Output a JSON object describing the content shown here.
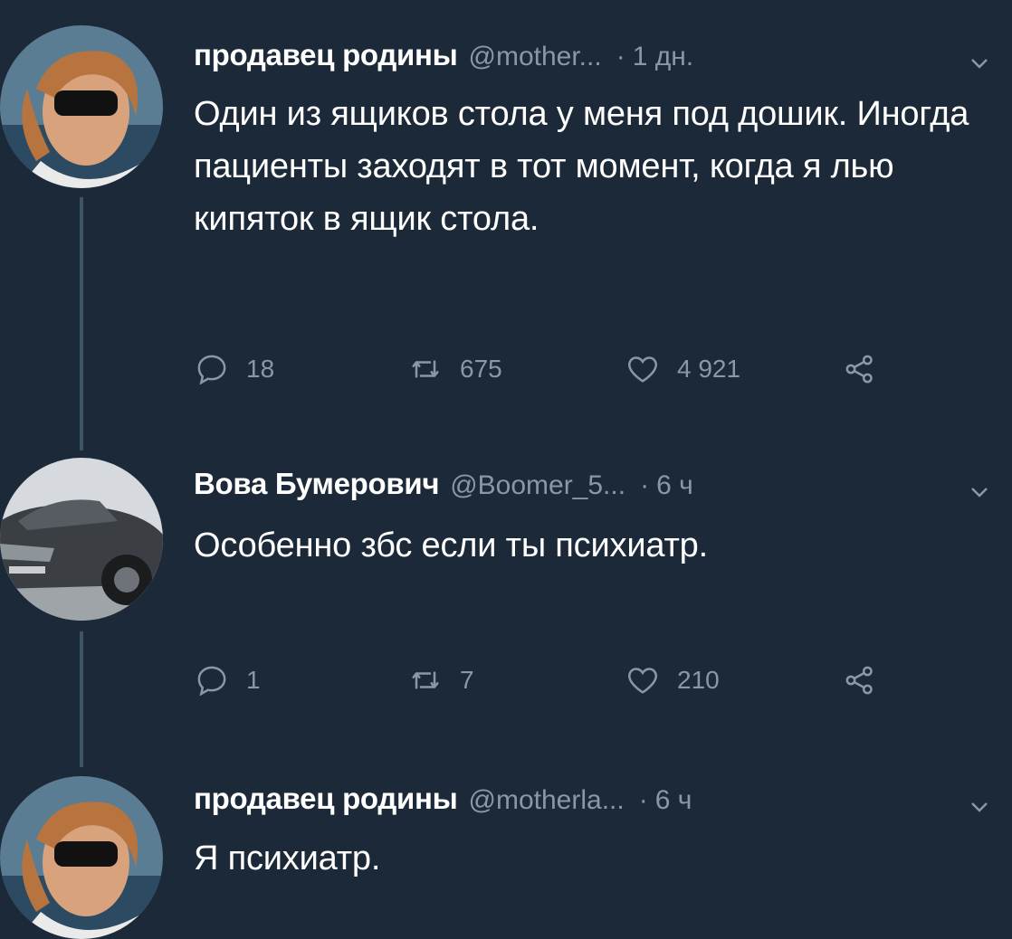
{
  "tweets": [
    {
      "name": "продавец родины",
      "handle": "@mother...",
      "separator": "·",
      "time": "1 дн.",
      "text": "Один из ящиков стола у меня под дошик. Иногда пациенты заходят в тот момент, когда я лью кипяток в ящик стола.",
      "replies": "18",
      "retweets": "675",
      "likes": "4 921"
    },
    {
      "name": "Вова Бумерович",
      "handle": "@Boomer_5...",
      "separator": "·",
      "time": "6 ч",
      "text": "Особенно збс если ты психиатр.",
      "replies": "1",
      "retweets": "7",
      "likes": "210"
    },
    {
      "name": "продавец родины",
      "handle": "@motherla...",
      "separator": "·",
      "time": "6 ч",
      "text": "Я психиатр."
    }
  ],
  "icons": {
    "reply": "reply-icon",
    "retweet": "retweet-icon",
    "like": "heart-icon",
    "share": "share-icon",
    "caret": "chevron-down-icon"
  },
  "colors": {
    "background": "#1c2938",
    "text": "#ffffff",
    "muted": "#8899a6",
    "thread_line": "#3d5466"
  }
}
